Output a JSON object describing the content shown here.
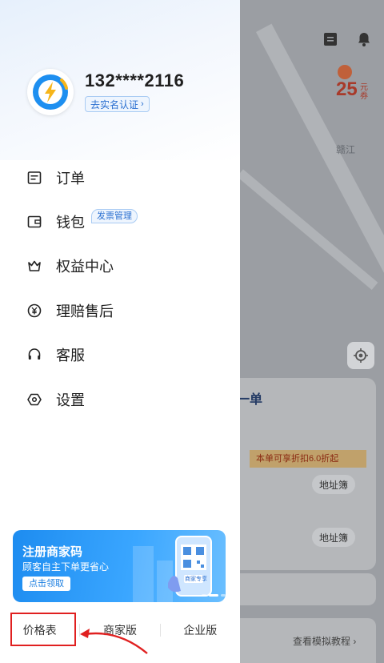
{
  "background": {
    "city_label": "赣江",
    "coupon": {
      "amount": "25",
      "unit_top": "元",
      "unit_bottom": "券"
    },
    "panel_title": "一单",
    "discount_text": "本单可享折扣6.0折起",
    "address_book_1": "地址簿",
    "address_book_2": "地址簿",
    "tutorial_link": "查看模拟教程 ›"
  },
  "profile": {
    "phone": "132****2116",
    "verify_label": "去实名认证",
    "verify_chevron": "›"
  },
  "menu": {
    "items": [
      {
        "label": "订单",
        "icon": "order-icon"
      },
      {
        "label": "钱包",
        "icon": "wallet-icon",
        "badge": "发票管理"
      },
      {
        "label": "权益中心",
        "icon": "crown-icon"
      },
      {
        "label": "理赔售后",
        "icon": "yen-circle-icon"
      },
      {
        "label": "客服",
        "icon": "headset-icon"
      },
      {
        "label": "设置",
        "icon": "settings-icon"
      }
    ]
  },
  "banner": {
    "title": "注册商家码",
    "subtitle": "顾客自主下单更省心",
    "button": "点击领取",
    "phone_badge": "商家专享"
  },
  "bottom_links": {
    "price_list": "价格表",
    "merchant": "商家版",
    "enterprise": "企业版"
  },
  "colors": {
    "accent": "#2a6fd0",
    "banner_blue": "#1d8cf0",
    "highlight_red": "#e02020"
  }
}
